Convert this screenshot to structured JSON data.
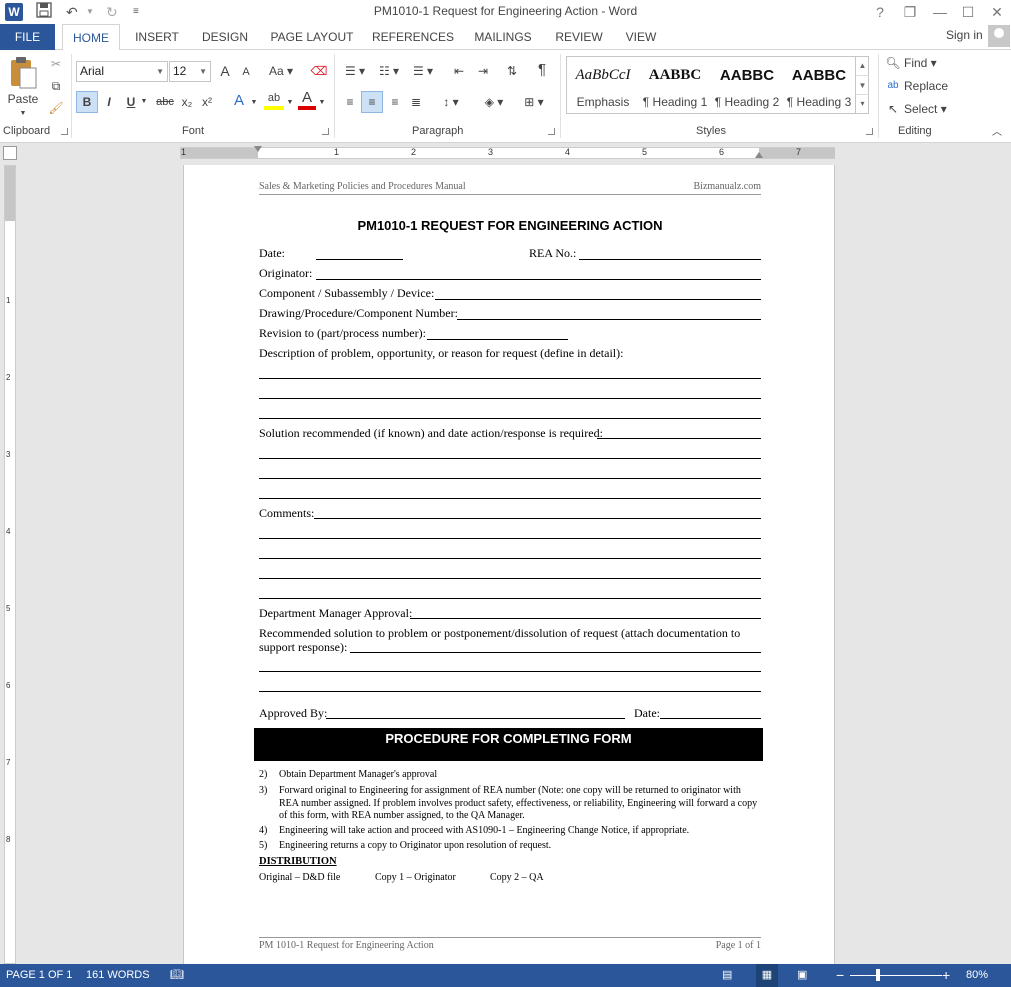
{
  "window": {
    "title": "PM1010-1 Request for Engineering Action - Word",
    "app_icon": "W",
    "controls": [
      "?",
      "❐",
      "—",
      "☐",
      "✕"
    ]
  },
  "ribbon_tabs": {
    "file": "FILE",
    "tabs": [
      "HOME",
      "INSERT",
      "DESIGN",
      "PAGE LAYOUT",
      "REFERENCES",
      "MAILINGS",
      "REVIEW",
      "VIEW"
    ],
    "active": "HOME",
    "sign_in": "Sign in"
  },
  "ribbon": {
    "clipboard": {
      "paste": "Paste",
      "label": "Clipboard"
    },
    "font": {
      "name": "Arial",
      "size": "12",
      "label": "Font",
      "grow": "A",
      "shrink": "A",
      "case": "Aa",
      "bold": "B",
      "italic": "I",
      "underline": "U",
      "strike": "abc",
      "sub": "x₂",
      "sup": "x²"
    },
    "paragraph": {
      "label": "Paragraph",
      "pilcrow": "¶"
    },
    "styles": {
      "label": "Styles",
      "items": [
        {
          "sample": "AaBbCcI",
          "name": "Emphasis"
        },
        {
          "sample": "AABBC",
          "name": "¶ Heading 1"
        },
        {
          "sample": "AABBC",
          "name": "¶ Heading 2"
        },
        {
          "sample": "AABBC",
          "name": "¶ Heading 3"
        }
      ]
    },
    "editing": {
      "label": "Editing",
      "find": "Find",
      "replace": "Replace",
      "select": "Select"
    }
  },
  "ruler": {
    "h_numbers": [
      "1",
      "1",
      "2",
      "3",
      "4",
      "5",
      "6",
      "7"
    ],
    "v_numbers": [
      "1",
      "2",
      "3",
      "4",
      "5",
      "6",
      "7",
      "8"
    ]
  },
  "document": {
    "header_left": "Sales & Marketing Policies and Procedures Manual",
    "header_right": "Bizmanualz.com",
    "title": "PM1010-1 REQUEST FOR ENGINEERING ACTION",
    "fields": {
      "date": "Date:",
      "rea_no": "REA No.:",
      "originator": "Originator:",
      "component": "Component / Subassembly / Device:",
      "drawing": "Drawing/Procedure/Component Number:",
      "revision": "Revision to (part/process number):",
      "description": "Description of problem, opportunity, or reason for request (define in detail):",
      "solution": "Solution recommended (if known) and date action/response is required:",
      "comments": "Comments:",
      "dept_approval": "Department Manager Approval:",
      "recommended_1": "Recommended solution to problem or postponement/dissolution of request (attach documentation to",
      "recommended_2": "support response):",
      "approved_by": "Approved By:",
      "date2": "Date:"
    },
    "procedure_heading": "PROCEDURE FOR COMPLETING FORM",
    "steps": [
      {
        "n": "2)",
        "text": "Obtain Department Manager's approval"
      },
      {
        "n": "3)",
        "text": "Forward original to Engineering for assignment of REA number (Note: one copy will be returned to originator with REA number assigned.  If problem involves product safety, effectiveness, or reliability, Engineering will forward a copy of this form, with REA number assigned, to the QA Manager."
      },
      {
        "n": "4)",
        "text": "Engineering will take action and proceed with AS1090-1 – Engineering Change Notice, if appropriate."
      },
      {
        "n": "5)",
        "text": "Engineering returns a copy to Originator upon resolution of request."
      }
    ],
    "distribution_heading": "DISTRIBUTION",
    "distribution": [
      "Original – D&D file",
      "Copy 1 – Originator",
      "Copy 2 – QA"
    ],
    "footer_left": "PM 1010-1 Request for Engineering Action",
    "footer_right": "Page 1 of 1"
  },
  "status": {
    "page": "PAGE 1 OF 1",
    "words": "161 WORDS",
    "zoom": "80%",
    "zoom_minus": "−",
    "zoom_plus": "+"
  }
}
